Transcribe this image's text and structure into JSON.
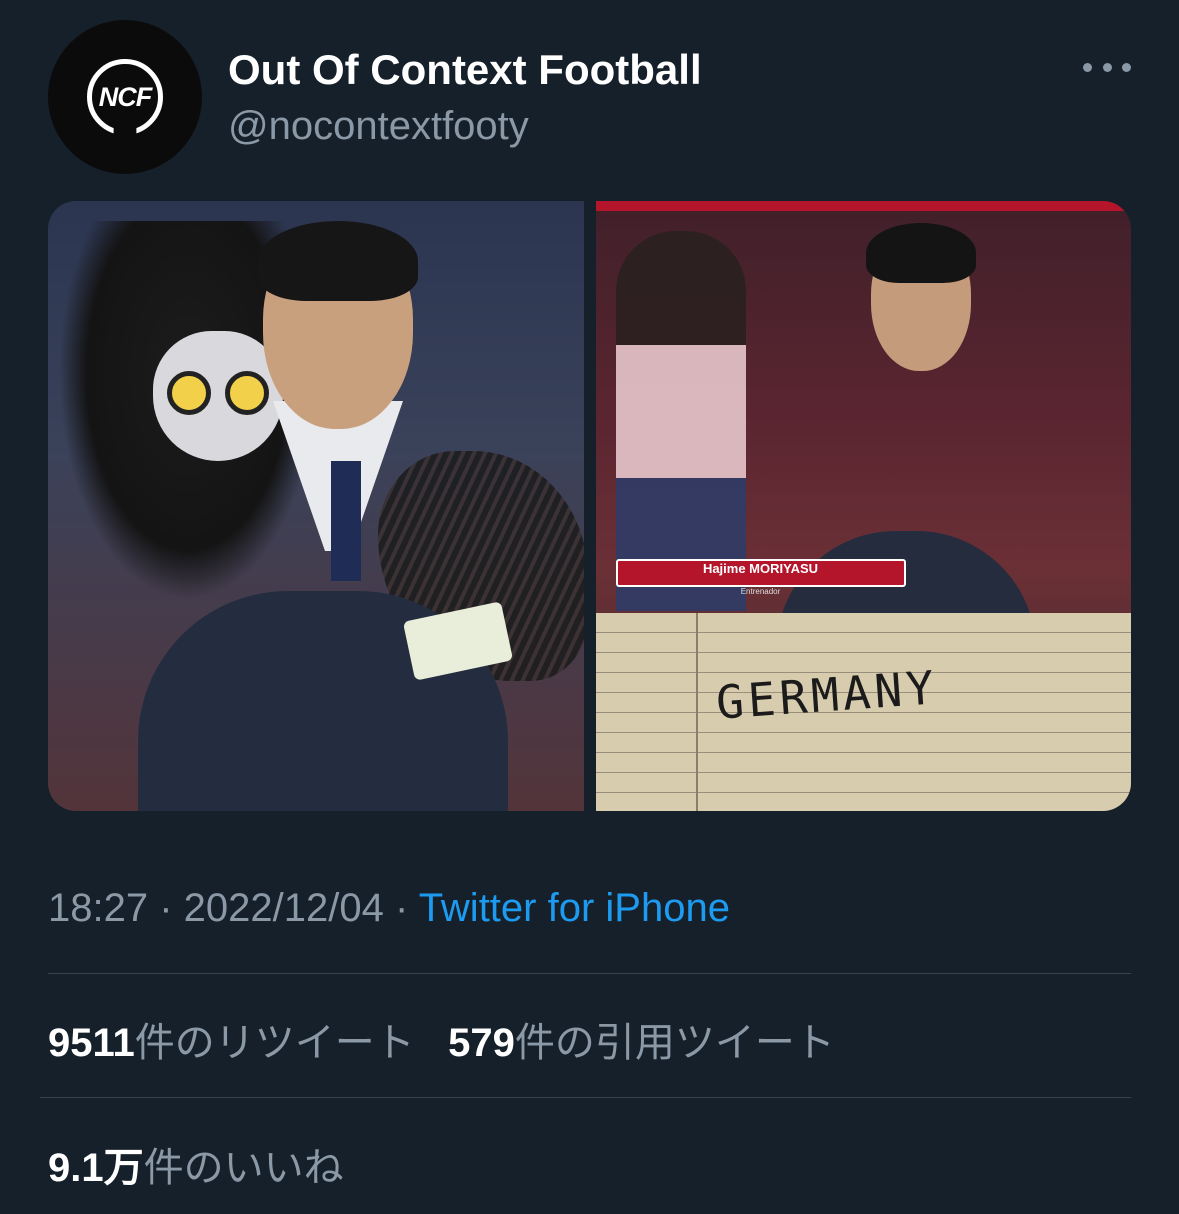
{
  "tweet": {
    "author": {
      "display_name": "Out Of Context Football",
      "handle": "@nocontextfooty",
      "avatar_text": "NCF"
    },
    "media": {
      "right_image_caption": {
        "name": "Hajime MORIYASU",
        "role": "Entrenador"
      },
      "right_image_note": "GERMANY"
    },
    "meta": {
      "time": "18:27",
      "separator": " · ",
      "date": "2022/12/04",
      "source": "Twitter for iPhone"
    },
    "stats": {
      "retweets_count": "9511",
      "retweets_label": "件のリツイート",
      "quotes_count": "579",
      "quotes_label": "件の引用ツイート",
      "likes_count": "9.1万",
      "likes_label": "件のいいね"
    }
  },
  "colors": {
    "background": "#15202b",
    "link": "#1d9bf0",
    "secondary_text": "#8b98a5",
    "divider": "#38444d"
  }
}
